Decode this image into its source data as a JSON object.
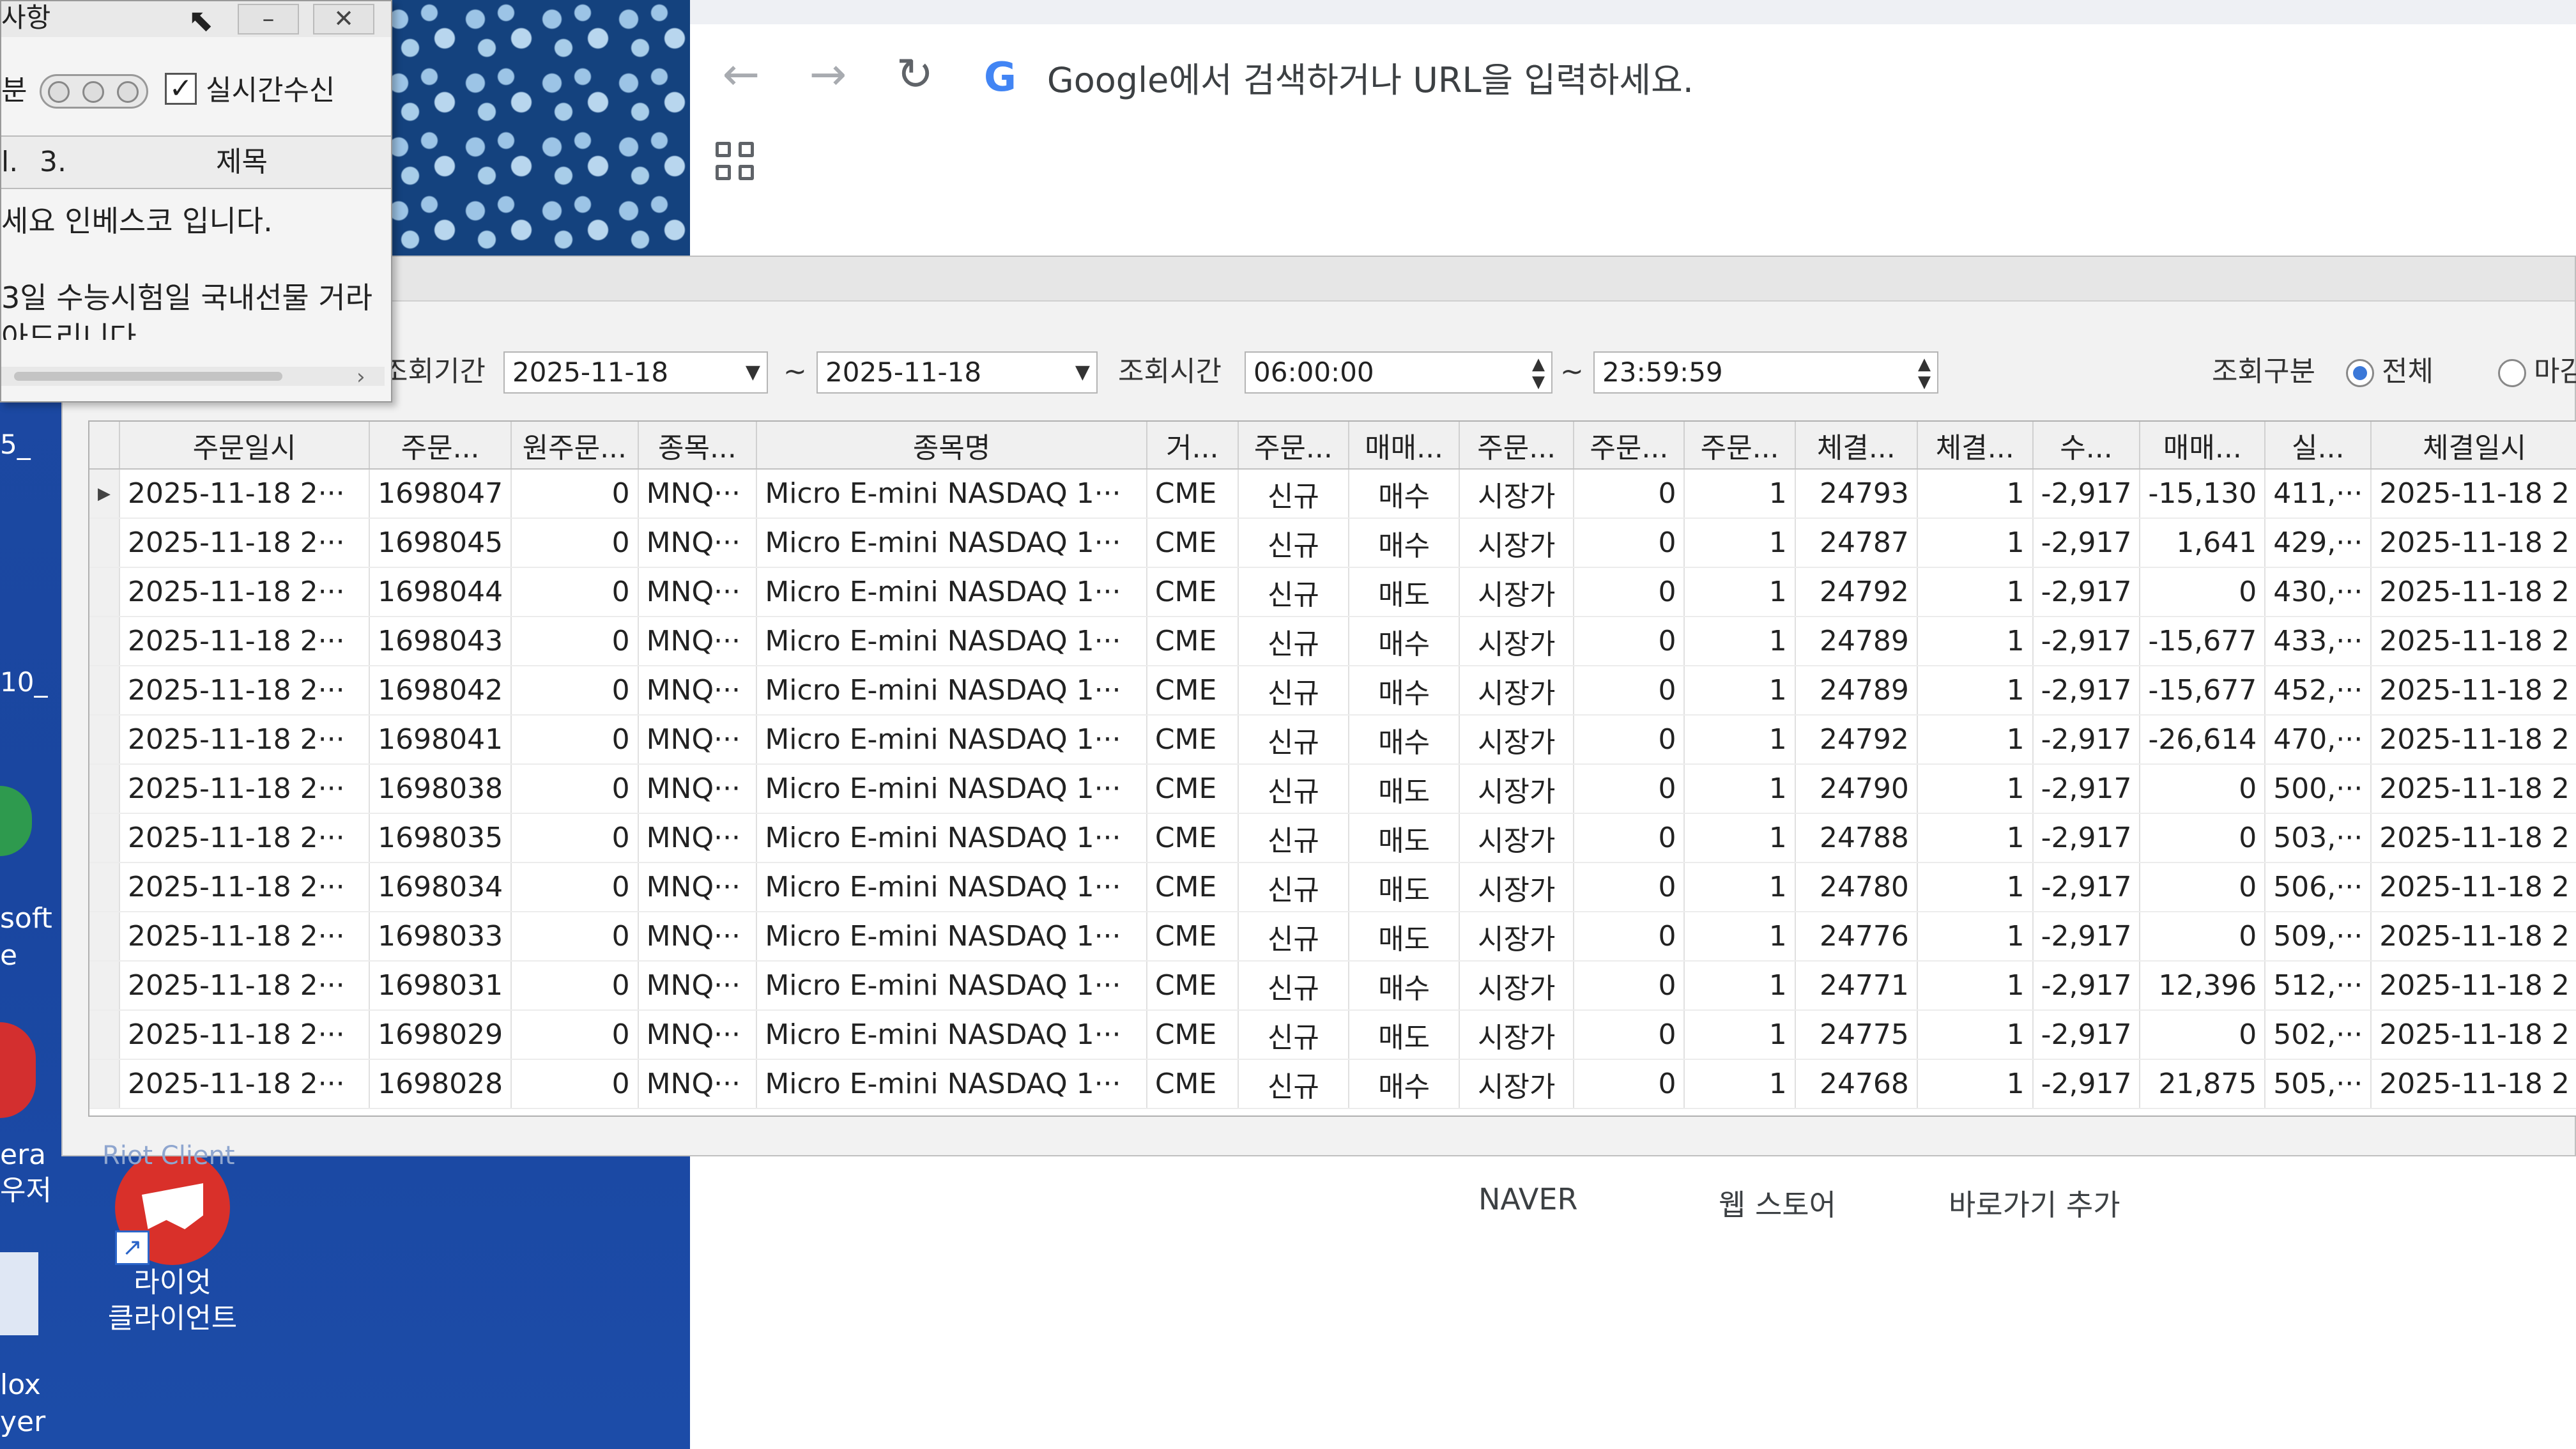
{
  "browser": {
    "address_placeholder": "Google에서 검색하거나 URL을 입력하세요.",
    "google_logo": "G",
    "back_icon": "←",
    "forward_icon": "→",
    "reload_icon": "↻",
    "bookmarks": [
      "NAVER",
      "웹 스토어",
      "바로가기 추가"
    ]
  },
  "notice": {
    "title": "사항",
    "minimize": "–",
    "close": "✕",
    "tool_left": "분",
    "realtime_label": "실시간수신",
    "realtime_checked": true,
    "col1": "l.",
    "col2": "3.",
    "col_title": "제목",
    "lines": [
      "세요 인베스코 입니다.",
      "3일 수능시험일 국내선물 거라",
      "아드리니다"
    ]
  },
  "desktop": {
    "left_labels": [
      "5_",
      "10_",
      "soft",
      "e",
      "era",
      "우저",
      "lox",
      "yer"
    ],
    "riot_client_label_line1": "라이엇",
    "riot_client_label_line2": "클라이언트",
    "riot_behind_label": "Riot Client"
  },
  "filters": {
    "period_label": "조회기간",
    "date_from": "2025-11-18",
    "tilde": "~",
    "date_to": "2025-11-18",
    "time_label": "조회시간",
    "time_from": "06:00:00",
    "time_to": "23:59:59",
    "type_label": "조회구분",
    "type_all": "전체",
    "type_other": "마감"
  },
  "table": {
    "columns": [
      "주문일시",
      "주문...",
      "원주문...",
      "종목...",
      "종목명",
      "거...",
      "주문...",
      "매매...",
      "주문...",
      "주문...",
      "주문...",
      "체결...",
      "체결...",
      "수...",
      "매매...",
      "실...",
      "체결일시"
    ],
    "rows": [
      {
        "date": "2025-11-18 2···",
        "order": "1698047",
        "orig": "0",
        "code": "MNQ···",
        "name": "Micro E-mini NASDAQ 1···",
        "exch": "CME",
        "kind": "신규",
        "side": "매수",
        "otype": "시장가",
        "c1": "0",
        "c2": "1",
        "price": "24793",
        "qty": "1",
        "fee": "-2,917",
        "pnl": "-15,130",
        "real": "411,···",
        "fill_time": "2025-11-18 2"
      },
      {
        "date": "2025-11-18 2···",
        "order": "1698045",
        "orig": "0",
        "code": "MNQ···",
        "name": "Micro E-mini NASDAQ 1···",
        "exch": "CME",
        "kind": "신규",
        "side": "매수",
        "otype": "시장가",
        "c1": "0",
        "c2": "1",
        "price": "24787",
        "qty": "1",
        "fee": "-2,917",
        "pnl": "1,641",
        "real": "429,···",
        "fill_time": "2025-11-18 2"
      },
      {
        "date": "2025-11-18 2···",
        "order": "1698044",
        "orig": "0",
        "code": "MNQ···",
        "name": "Micro E-mini NASDAQ 1···",
        "exch": "CME",
        "kind": "신규",
        "side": "매도",
        "otype": "시장가",
        "c1": "0",
        "c2": "1",
        "price": "24792",
        "qty": "1",
        "fee": "-2,917",
        "pnl": "0",
        "real": "430,···",
        "fill_time": "2025-11-18 2"
      },
      {
        "date": "2025-11-18 2···",
        "order": "1698043",
        "orig": "0",
        "code": "MNQ···",
        "name": "Micro E-mini NASDAQ 1···",
        "exch": "CME",
        "kind": "신규",
        "side": "매수",
        "otype": "시장가",
        "c1": "0",
        "c2": "1",
        "price": "24789",
        "qty": "1",
        "fee": "-2,917",
        "pnl": "-15,677",
        "real": "433,···",
        "fill_time": "2025-11-18 2"
      },
      {
        "date": "2025-11-18 2···",
        "order": "1698042",
        "orig": "0",
        "code": "MNQ···",
        "name": "Micro E-mini NASDAQ 1···",
        "exch": "CME",
        "kind": "신규",
        "side": "매수",
        "otype": "시장가",
        "c1": "0",
        "c2": "1",
        "price": "24789",
        "qty": "1",
        "fee": "-2,917",
        "pnl": "-15,677",
        "real": "452,···",
        "fill_time": "2025-11-18 2"
      },
      {
        "date": "2025-11-18 2···",
        "order": "1698041",
        "orig": "0",
        "code": "MNQ···",
        "name": "Micro E-mini NASDAQ 1···",
        "exch": "CME",
        "kind": "신규",
        "side": "매수",
        "otype": "시장가",
        "c1": "0",
        "c2": "1",
        "price": "24792",
        "qty": "1",
        "fee": "-2,917",
        "pnl": "-26,614",
        "real": "470,···",
        "fill_time": "2025-11-18 2"
      },
      {
        "date": "2025-11-18 2···",
        "order": "1698038",
        "orig": "0",
        "code": "MNQ···",
        "name": "Micro E-mini NASDAQ 1···",
        "exch": "CME",
        "kind": "신규",
        "side": "매도",
        "otype": "시장가",
        "c1": "0",
        "c2": "1",
        "price": "24790",
        "qty": "1",
        "fee": "-2,917",
        "pnl": "0",
        "real": "500,···",
        "fill_time": "2025-11-18 2"
      },
      {
        "date": "2025-11-18 2···",
        "order": "1698035",
        "orig": "0",
        "code": "MNQ···",
        "name": "Micro E-mini NASDAQ 1···",
        "exch": "CME",
        "kind": "신규",
        "side": "매도",
        "otype": "시장가",
        "c1": "0",
        "c2": "1",
        "price": "24788",
        "qty": "1",
        "fee": "-2,917",
        "pnl": "0",
        "real": "503,···",
        "fill_time": "2025-11-18 2"
      },
      {
        "date": "2025-11-18 2···",
        "order": "1698034",
        "orig": "0",
        "code": "MNQ···",
        "name": "Micro E-mini NASDAQ 1···",
        "exch": "CME",
        "kind": "신규",
        "side": "매도",
        "otype": "시장가",
        "c1": "0",
        "c2": "1",
        "price": "24780",
        "qty": "1",
        "fee": "-2,917",
        "pnl": "0",
        "real": "506,···",
        "fill_time": "2025-11-18 2"
      },
      {
        "date": "2025-11-18 2···",
        "order": "1698033",
        "orig": "0",
        "code": "MNQ···",
        "name": "Micro E-mini NASDAQ 1···",
        "exch": "CME",
        "kind": "신규",
        "side": "매도",
        "otype": "시장가",
        "c1": "0",
        "c2": "1",
        "price": "24776",
        "qty": "1",
        "fee": "-2,917",
        "pnl": "0",
        "real": "509,···",
        "fill_time": "2025-11-18 2"
      },
      {
        "date": "2025-11-18 2···",
        "order": "1698031",
        "orig": "0",
        "code": "MNQ···",
        "name": "Micro E-mini NASDAQ 1···",
        "exch": "CME",
        "kind": "신규",
        "side": "매수",
        "otype": "시장가",
        "c1": "0",
        "c2": "1",
        "price": "24771",
        "qty": "1",
        "fee": "-2,917",
        "pnl": "12,396",
        "real": "512,···",
        "fill_time": "2025-11-18 2"
      },
      {
        "date": "2025-11-18 2···",
        "order": "1698029",
        "orig": "0",
        "code": "MNQ···",
        "name": "Micro E-mini NASDAQ 1···",
        "exch": "CME",
        "kind": "신규",
        "side": "매도",
        "otype": "시장가",
        "c1": "0",
        "c2": "1",
        "price": "24775",
        "qty": "1",
        "fee": "-2,917",
        "pnl": "0",
        "real": "502,···",
        "fill_time": "2025-11-18 2"
      },
      {
        "date": "2025-11-18 2···",
        "order": "1698028",
        "orig": "0",
        "code": "MNQ···",
        "name": "Micro E-mini NASDAQ 1···",
        "exch": "CME",
        "kind": "신규",
        "side": "매수",
        "otype": "시장가",
        "c1": "0",
        "c2": "1",
        "price": "24768",
        "qty": "1",
        "fee": "-2,917",
        "pnl": "21,875",
        "real": "505,···",
        "fill_time": "2025-11-18 2"
      }
    ]
  },
  "colors": {
    "buy": "#e23b2c",
    "sell": "#a9c2e6",
    "faint": "#b4b9c4",
    "profit_red": "#d33a2a",
    "desktop_blue": "#1d4aa3"
  }
}
